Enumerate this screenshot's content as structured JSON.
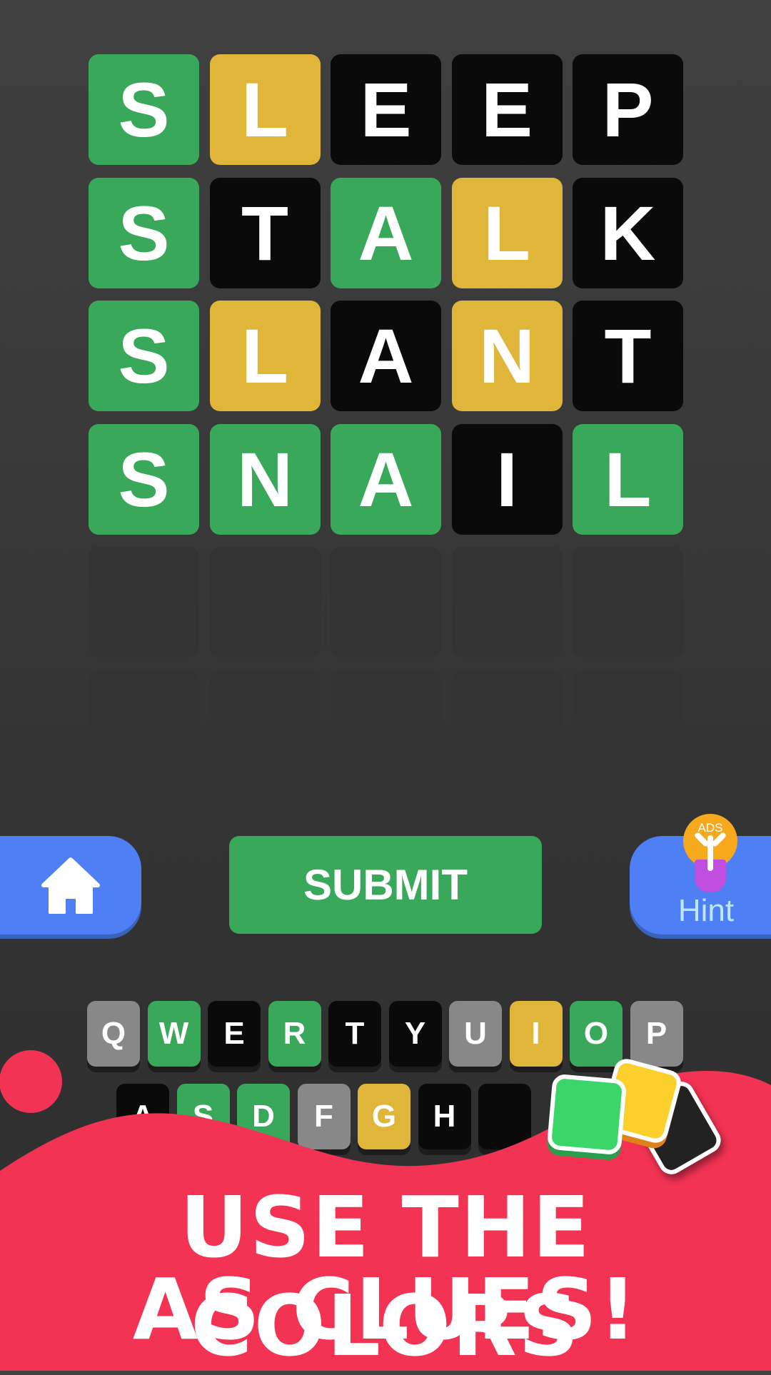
{
  "colors": {
    "correct": "#3aa85a",
    "present": "#dfb63a",
    "absent": "#0a0a0a",
    "empty": "#333333",
    "unused": "#888888",
    "accent_blue": "#4e7ff4",
    "banner_red": "#f23353"
  },
  "board": [
    [
      {
        "letter": "S",
        "state": "correct"
      },
      {
        "letter": "L",
        "state": "present"
      },
      {
        "letter": "E",
        "state": "absent"
      },
      {
        "letter": "E",
        "state": "absent"
      },
      {
        "letter": "P",
        "state": "absent"
      }
    ],
    [
      {
        "letter": "S",
        "state": "correct"
      },
      {
        "letter": "T",
        "state": "absent"
      },
      {
        "letter": "A",
        "state": "correct"
      },
      {
        "letter": "L",
        "state": "present"
      },
      {
        "letter": "K",
        "state": "absent"
      }
    ],
    [
      {
        "letter": "S",
        "state": "correct"
      },
      {
        "letter": "L",
        "state": "present"
      },
      {
        "letter": "A",
        "state": "absent"
      },
      {
        "letter": "N",
        "state": "present"
      },
      {
        "letter": "T",
        "state": "absent"
      }
    ],
    [
      {
        "letter": "S",
        "state": "correct"
      },
      {
        "letter": "N",
        "state": "correct"
      },
      {
        "letter": "A",
        "state": "correct"
      },
      {
        "letter": "I",
        "state": "absent"
      },
      {
        "letter": "L",
        "state": "correct"
      }
    ],
    [
      {
        "letter": "",
        "state": "empty"
      },
      {
        "letter": "",
        "state": "empty"
      },
      {
        "letter": "",
        "state": "empty"
      },
      {
        "letter": "",
        "state": "empty"
      },
      {
        "letter": "",
        "state": "empty"
      }
    ],
    [
      {
        "letter": "",
        "state": "empty"
      },
      {
        "letter": "",
        "state": "empty"
      },
      {
        "letter": "",
        "state": "empty"
      },
      {
        "letter": "",
        "state": "empty"
      },
      {
        "letter": "",
        "state": "empty"
      }
    ]
  ],
  "controls": {
    "home_icon": "home-icon",
    "submit_label": "SUBMIT",
    "hint_label": "Hint",
    "hint_badge": "ADS",
    "hint_icon": "lightbulb-icon"
  },
  "keyboard": [
    [
      {
        "key": "Q",
        "state": "unused"
      },
      {
        "key": "W",
        "state": "correct"
      },
      {
        "key": "E",
        "state": "absent"
      },
      {
        "key": "R",
        "state": "correct"
      },
      {
        "key": "T",
        "state": "absent"
      },
      {
        "key": "Y",
        "state": "absent"
      },
      {
        "key": "U",
        "state": "unused"
      },
      {
        "key": "I",
        "state": "present"
      },
      {
        "key": "O",
        "state": "correct"
      },
      {
        "key": "P",
        "state": "unused"
      }
    ],
    [
      {
        "key": "A",
        "state": "absent"
      },
      {
        "key": "S",
        "state": "correct"
      },
      {
        "key": "D",
        "state": "correct"
      },
      {
        "key": "F",
        "state": "unused"
      },
      {
        "key": "G",
        "state": "present"
      },
      {
        "key": "H",
        "state": "absent"
      },
      {
        "key": "",
        "state": "absent"
      }
    ]
  ],
  "banner": {
    "line1": "USE THE COLORS",
    "line2": "AS CLUES!"
  }
}
